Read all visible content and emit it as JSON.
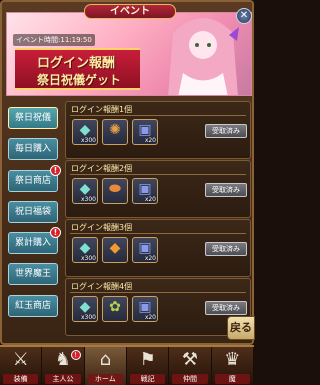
{
  "window": {
    "title": "イベント"
  },
  "banner": {
    "event_time_label": "イベント時間:",
    "event_time_value": "11:19:50",
    "title_line1": "ログイン報酬",
    "title_line2": "祭日祝儀ゲット"
  },
  "sidebar": {
    "items": [
      {
        "label": "祭日祝儀",
        "badge": ""
      },
      {
        "label": "毎日購入",
        "badge": ""
      },
      {
        "label": "祭日商店",
        "badge": "!"
      },
      {
        "label": "祝日福袋",
        "badge": ""
      },
      {
        "label": "累計購入",
        "badge": "!"
      },
      {
        "label": "世界魔王",
        "badge": ""
      },
      {
        "label": "紅玉商店",
        "badge": ""
      }
    ]
  },
  "rewards": {
    "cards": [
      {
        "title": "ログイン報酬1個",
        "items": [
          {
            "icon": "gem-icon",
            "qty": "x300"
          },
          {
            "icon": "medal-icon",
            "qty": ""
          },
          {
            "icon": "ticket-icon",
            "qty": "x20"
          }
        ],
        "button": "受取済み"
      },
      {
        "title": "ログイン報酬2個",
        "items": [
          {
            "icon": "gem-icon",
            "qty": "x300"
          },
          {
            "icon": "bread-icon",
            "qty": ""
          },
          {
            "icon": "ticket-icon",
            "qty": "x20"
          }
        ],
        "button": "受取済み"
      },
      {
        "title": "ログイン報酬3個",
        "items": [
          {
            "icon": "gem-icon",
            "qty": "x300"
          },
          {
            "icon": "orange-crystal-icon",
            "qty": ""
          },
          {
            "icon": "ticket-icon",
            "qty": "x20"
          }
        ],
        "button": "受取済み"
      },
      {
        "title": "ログイン報酬4個",
        "items": [
          {
            "icon": "gem-icon",
            "qty": "x300"
          },
          {
            "icon": "herb-icon",
            "qty": ""
          },
          {
            "icon": "ticket-icon",
            "qty": "x20"
          }
        ],
        "button": "受取済み"
      }
    ]
  },
  "back_button": "戻る",
  "bottom_nav": {
    "items": [
      {
        "label": "装備",
        "icon": "sword-icon",
        "badge": ""
      },
      {
        "label": "主人公",
        "icon": "hero-icon",
        "badge": "!"
      },
      {
        "label": "ホーム",
        "icon": "home-icon",
        "badge": ""
      },
      {
        "label": "戦記",
        "icon": "flag-icon",
        "badge": ""
      },
      {
        "label": "仲間",
        "icon": "team-icon",
        "badge": ""
      },
      {
        "label": "魔",
        "icon": "demon-icon",
        "badge": ""
      }
    ]
  },
  "colors": {
    "accent": "#c81e3a",
    "sidebar": "#3a7a8a",
    "panel": "#3a2414"
  }
}
